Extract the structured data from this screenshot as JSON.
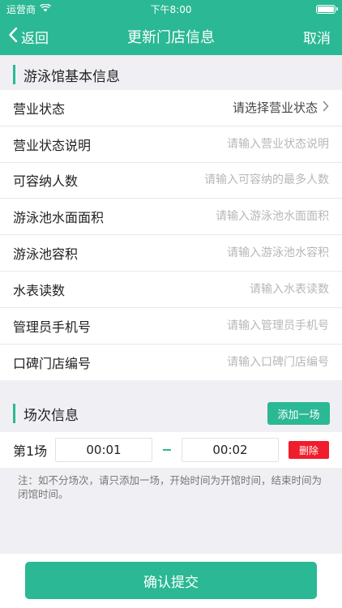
{
  "status_bar": {
    "carrier": "运营商",
    "time": "下午8:00"
  },
  "nav": {
    "back_label": "返回",
    "title": "更新门店信息",
    "cancel_label": "取消"
  },
  "basic_section": {
    "title": "游泳馆基本信息",
    "status_select": {
      "label": "营业状态",
      "value": "请选择营业状态"
    },
    "fields": [
      {
        "label": "营业状态说明",
        "placeholder": "请输入营业状态说明"
      },
      {
        "label": "可容纳人数",
        "placeholder": "请输入可容纳的最多人数"
      },
      {
        "label": "游泳池水面面积",
        "placeholder": "请输入游泳池水面面积"
      },
      {
        "label": "游泳池容积",
        "placeholder": "请输入游泳池水容积"
      },
      {
        "label": "水表读数",
        "placeholder": "请输入水表读数"
      },
      {
        "label": "管理员手机号",
        "placeholder": "请输入管理员手机号"
      },
      {
        "label": "口碑门店编号",
        "placeholder": "请输入口碑门店编号"
      }
    ]
  },
  "session_section": {
    "title": "场次信息",
    "add_label": "添加一场",
    "sessions": [
      {
        "label": "第1场",
        "start": "00:01",
        "end": "00:02",
        "delete_label": "删除"
      }
    ],
    "note": "注：如不分场次，请只添加一场，开始时间为开馆时间，结束时间为闭馆时间。"
  },
  "submit_label": "确认提交",
  "colors": {
    "accent": "#2bb894",
    "danger": "#f01d2c",
    "background": "#f0f0f4"
  },
  "battery_level": 1.0
}
